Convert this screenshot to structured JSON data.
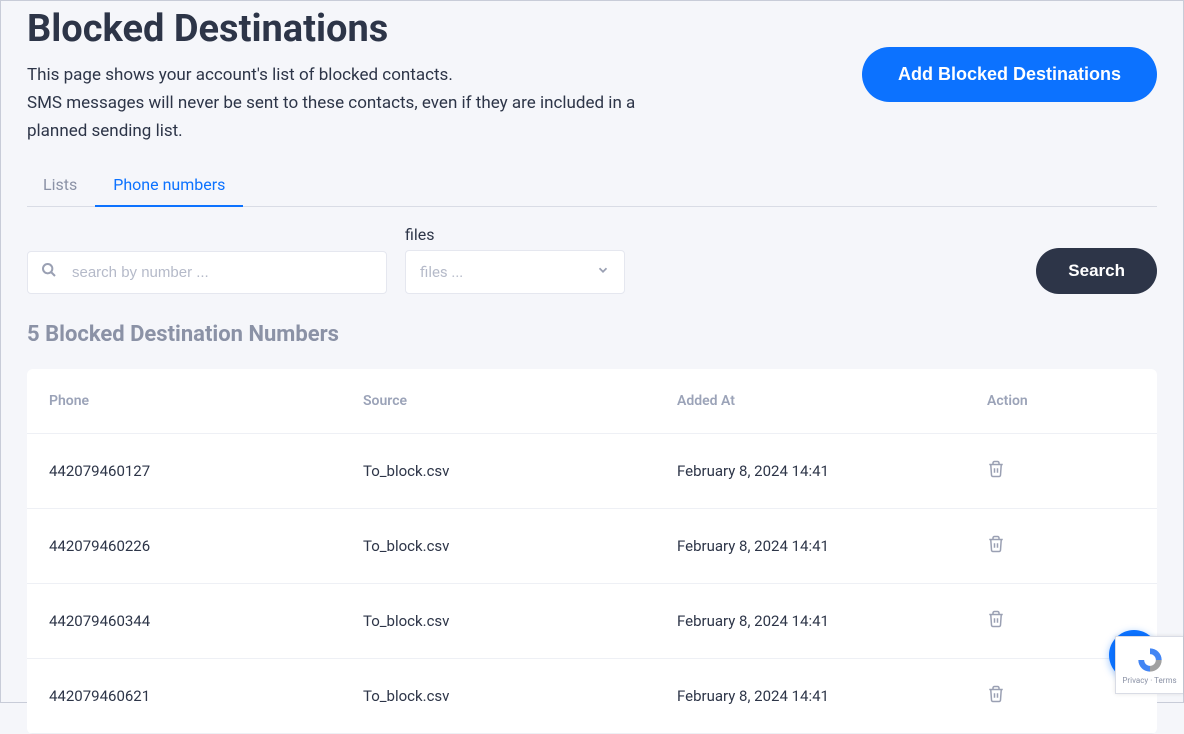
{
  "header": {
    "title": "Blocked Destinations",
    "description_line1": "This page shows your account's list of blocked contacts.",
    "description_line2": "SMS messages will never be sent to these contacts, even if they are included in a planned sending list.",
    "add_button": "Add Blocked Destinations"
  },
  "tabs": {
    "lists": "Lists",
    "phone_numbers": "Phone numbers"
  },
  "filters": {
    "search_placeholder": "search by number ...",
    "files_label": "files",
    "files_placeholder": "files ...",
    "search_button": "Search"
  },
  "count_title": "5 Blocked Destination Numbers",
  "table": {
    "headers": {
      "phone": "Phone",
      "source": "Source",
      "added_at": "Added At",
      "action": "Action"
    },
    "rows": [
      {
        "phone": "442079460127",
        "source": "To_block.csv",
        "added_at": "February 8, 2024 14:41"
      },
      {
        "phone": "442079460226",
        "source": "To_block.csv",
        "added_at": "February 8, 2024 14:41"
      },
      {
        "phone": "442079460344",
        "source": "To_block.csv",
        "added_at": "February 8, 2024 14:41"
      },
      {
        "phone": "442079460621",
        "source": "To_block.csv",
        "added_at": "February 8, 2024 14:41"
      }
    ]
  },
  "recaptcha": "Privacy · Terms"
}
